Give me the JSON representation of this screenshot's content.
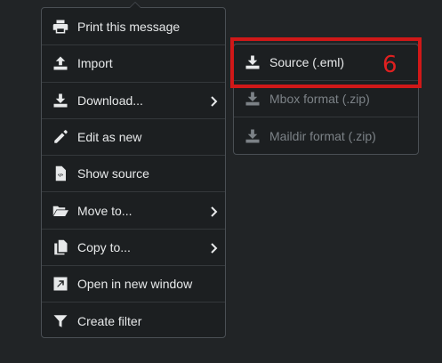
{
  "menu": {
    "items": [
      {
        "label": "Print this message",
        "icon": "print-icon",
        "has_submenu": false
      },
      {
        "label": "Import",
        "icon": "upload-icon",
        "has_submenu": false
      },
      {
        "label": "Download...",
        "icon": "download-icon",
        "has_submenu": true
      },
      {
        "label": "Edit as new",
        "icon": "pencil-icon",
        "has_submenu": false
      },
      {
        "label": "Show source",
        "icon": "source-file-icon",
        "has_submenu": false
      },
      {
        "label": "Move to...",
        "icon": "folder-open-icon",
        "has_submenu": true
      },
      {
        "label": "Copy to...",
        "icon": "copy-icon",
        "has_submenu": true
      },
      {
        "label": "Open in new window",
        "icon": "external-window-icon",
        "has_submenu": false
      },
      {
        "label": "Create filter",
        "icon": "filter-icon",
        "has_submenu": false
      }
    ]
  },
  "submenu": {
    "items": [
      {
        "label": "Source (.eml)",
        "icon": "download-icon",
        "enabled": true
      },
      {
        "label": "Mbox format (.zip)",
        "icon": "download-icon",
        "enabled": false
      },
      {
        "label": "Maildir format (.zip)",
        "icon": "download-icon",
        "enabled": false
      }
    ]
  },
  "annotation": {
    "step_number": "6",
    "color": "#d01818"
  },
  "colors": {
    "background": "#212426",
    "menu_background": "#1c1f21",
    "text": "#e7e9ea",
    "disabled_text": "#7c8287"
  }
}
